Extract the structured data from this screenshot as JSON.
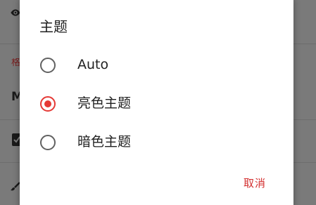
{
  "dialog": {
    "title": "主题",
    "options": [
      {
        "label": "Auto",
        "selected": false
      },
      {
        "label": "亮色主题",
        "selected": true
      },
      {
        "label": "暗色主题",
        "selected": false
      }
    ],
    "cancel_label": "取消"
  },
  "background": {
    "partial_accent_text": "格",
    "partial_item_text": "M"
  },
  "colors": {
    "accent": "#e53935",
    "scrim": "#7a7a7a",
    "dialog_bg": "#ffffff"
  },
  "icons": {
    "visibility": "eye-icon",
    "checkbox": "checkbox-icon",
    "brush": "brush-icon"
  }
}
